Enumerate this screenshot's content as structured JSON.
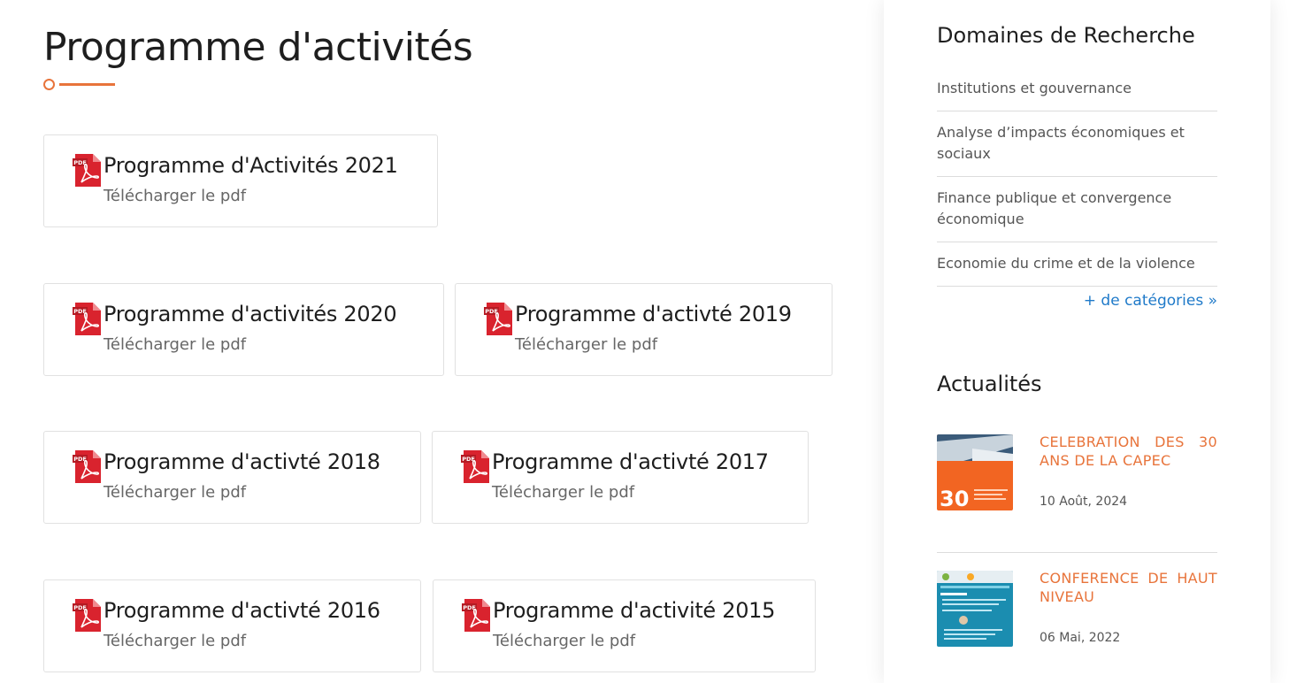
{
  "page": {
    "title": "Programme d'activités"
  },
  "colors": {
    "accent": "#e8743b",
    "link": "#1f7ac9",
    "pdf_red": "#d9232e"
  },
  "documents": [
    {
      "title": "Programme d'Activités 2021",
      "link": "Télécharger le pdf",
      "icon": "pdf-icon"
    },
    {
      "title": "Programme d'activités 2020",
      "link": "Télécharger le pdf",
      "icon": "pdf-icon"
    },
    {
      "title": "Programme d'activté 2019",
      "link": "Télécharger le pdf",
      "icon": "pdf-icon"
    },
    {
      "title": "Programme d'activté 2018",
      "link": "Télécharger le pdf",
      "icon": "pdf-icon"
    },
    {
      "title": "Programme d'activté 2017",
      "link": "Télécharger le pdf",
      "icon": "pdf-icon"
    },
    {
      "title": "Programme d'activté 2016",
      "link": "Télécharger le pdf",
      "icon": "pdf-icon"
    },
    {
      "title": "Programme d'activité 2015",
      "link": "Télécharger le pdf",
      "icon": "pdf-icon"
    }
  ],
  "sidebar": {
    "research": {
      "heading": "Domaines de Recherche",
      "items": [
        "Institutions et gouvernance",
        "Analyse d’impacts économiques et sociaux",
        "Finance publique et convergence économique",
        "Economie du crime et de la violence"
      ],
      "more": "+ de catégories »"
    },
    "news": {
      "heading": "Actualités",
      "items": [
        {
          "title": "CELEBRATION DES 30 ANS DE LA CAPEC",
          "date": "10 Août, 2024"
        },
        {
          "title": "CONFERENCE DE HAUT NIVEAU",
          "date": "06 Mai, 2022"
        }
      ]
    }
  }
}
